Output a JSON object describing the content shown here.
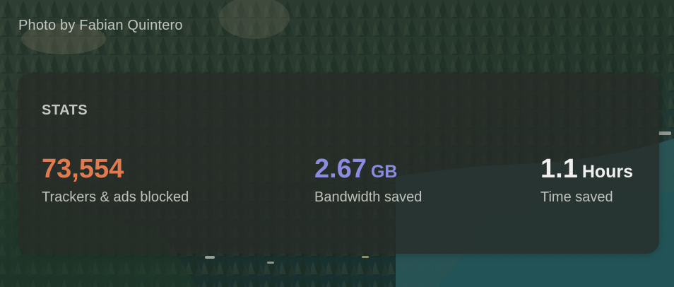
{
  "photo_credit": "Photo by Fabian Quintero",
  "stats": {
    "title": "STATS",
    "items": [
      {
        "value": "73,554",
        "unit": "",
        "label": "Trackers & ads blocked",
        "color": "#e07a50"
      },
      {
        "value": "2.67",
        "unit": "GB",
        "label": "Bandwidth saved",
        "color": "#8b8be0"
      },
      {
        "value": "1.1",
        "unit": "Hours",
        "label": "Time saved",
        "color": "#f0f0ee"
      }
    ]
  }
}
